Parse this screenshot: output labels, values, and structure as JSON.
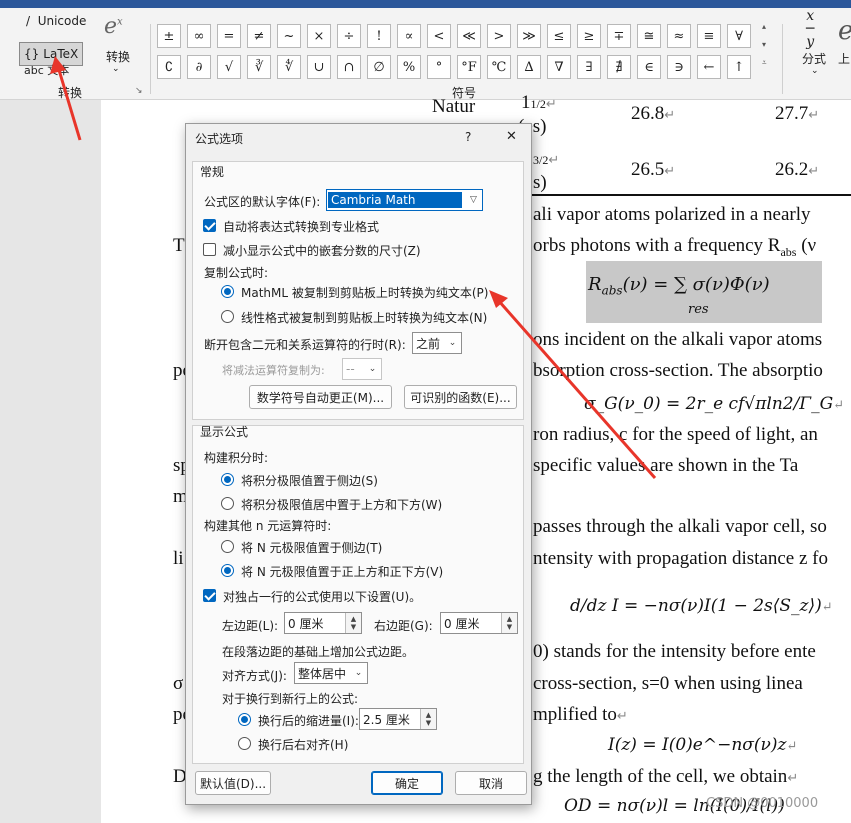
{
  "ribbon": {
    "unicode": "Unicode",
    "latex": "LaTeX",
    "text": "abc 文本",
    "convert": "转换",
    "convert_group": "转换",
    "symbols_group": "符号",
    "fraction": "分式",
    "upper": "上",
    "symbols_row1": [
      "±",
      "∞",
      "=",
      "≠",
      "~",
      "×",
      "÷",
      "!",
      "∝",
      "<",
      "≪",
      ">",
      "≫",
      "≤",
      "≥",
      "∓",
      "≅",
      "≈",
      "≡",
      "∀"
    ],
    "symbols_row2": [
      "∁",
      "∂",
      "√",
      "∛",
      "∜",
      "∪",
      "∩",
      "∅",
      "%",
      "°",
      "°F",
      "℃",
      "∆",
      "∇",
      "∃",
      "∄",
      "∈",
      "∋",
      "←",
      "↑"
    ]
  },
  "document": {
    "t1": "Natur",
    "t2": "1",
    "t2b": "1/2",
    "t3": "(es)",
    "v1": "26.8",
    "v2": "27.7",
    "t4": "3/2",
    "t5": "s)",
    "v3": "26.5",
    "v4": "26.2",
    "line1": "ali vapor atoms polarized in a nearly",
    "line2a": "T",
    "line2": "orbs photons with a frequency R",
    "line2sub": "abs",
    "line2c": "(ν",
    "line3a": "po",
    "line3": "ons incident on the alkali vapor atoms",
    "line4": "bsorption cross-section. The absorptio",
    "line5": "ron radius, c for the speed of light, an",
    "line6a": "sp",
    "line6": "specific values are shown in the Ta",
    "line7a": "m",
    "line8": "passes through the alkali vapor cell, so",
    "line9a": "li",
    "line9": "ntensity with propagation distance z fo",
    "line10": "0) stands for the intensity before ente",
    "line11a": "σ",
    "line11": "cross-section, s=0 when using linea",
    "line12a": "po",
    "line12": "mplified to",
    "line13a": "D",
    "line13": "g the length of the cell, we obtain",
    "eq1": "R",
    "eq1sub": "abs",
    "eq1rest": "(ν) = ∑ σ(ν)Φ(ν)",
    "eq1under": "res",
    "eq2": "σ_G(ν_0) = 2r_e cf√πln2/Γ_G",
    "eq3": "d/dz I = −nσ(ν)I(1 − 2s⟨S_z⟩)",
    "eq4": "I(z) = I(0)e^−nσ(ν)z",
    "eq5": "OD = nσ(ν)l = ln(I(0)/I(l))",
    "watermark": "CSDN @0010000"
  },
  "dialog": {
    "title": "公式选项",
    "help": "?",
    "close": "✕",
    "section_general": "常规",
    "default_font_label": "公式区的默认字体(F):",
    "default_font_value": "Cambria Math",
    "auto_convert": "自动将表达式转换到专业格式",
    "reduce_size": "减小显示公式中的嵌套分数的尺寸(Z)",
    "copy_label": "复制公式时:",
    "copy_mathml": "MathML 被复制到剪贴板上时转换为纯文本(P)",
    "copy_linear": "线性格式被复制到剪贴板上时转换为纯文本(N)",
    "break_label": "断开包含二元和关系运算符的行时(R):",
    "break_value": "之前",
    "minus_label": "将减法运算符复制为:",
    "minus_value": "--",
    "autocorrect_btn": "数学符号自动更正(M)...",
    "functions_btn": "可识别的函数(E)...",
    "section_display": "显示公式",
    "integral_label": "构建积分时:",
    "integral_side": "将积分极限值置于侧边(S)",
    "integral_center": "将积分极限值居中置于上方和下方(W)",
    "nary_label": "构建其他 n 元运算符时:",
    "nary_side": "将 N 元极限值置于侧边(T)",
    "nary_center": "将 N 元极限值置于正上方和正下方(V)",
    "standalone": "对独占一行的公式使用以下设置(U)。",
    "left_margin_label": "左边距(L):",
    "left_margin_value": "0 厘米",
    "right_margin_label": "右边距(G):",
    "right_margin_value": "0 厘米",
    "margin_note": "在段落边距的基础上增加公式边距。",
    "align_label": "对齐方式(J):",
    "align_value": "整体居中",
    "wrap_label": "对于换行到新行上的公式:",
    "wrap_indent": "换行后的缩进量(I):",
    "wrap_indent_value": "2.5 厘米",
    "wrap_right": "换行后右对齐(H)",
    "default_btn": "默认值(D)...",
    "ok_btn": "确定",
    "cancel_btn": "取消"
  },
  "colors": {
    "accent": "#0067c0",
    "annotation": "#e8352a",
    "ribbon_top": "#2b579a"
  }
}
